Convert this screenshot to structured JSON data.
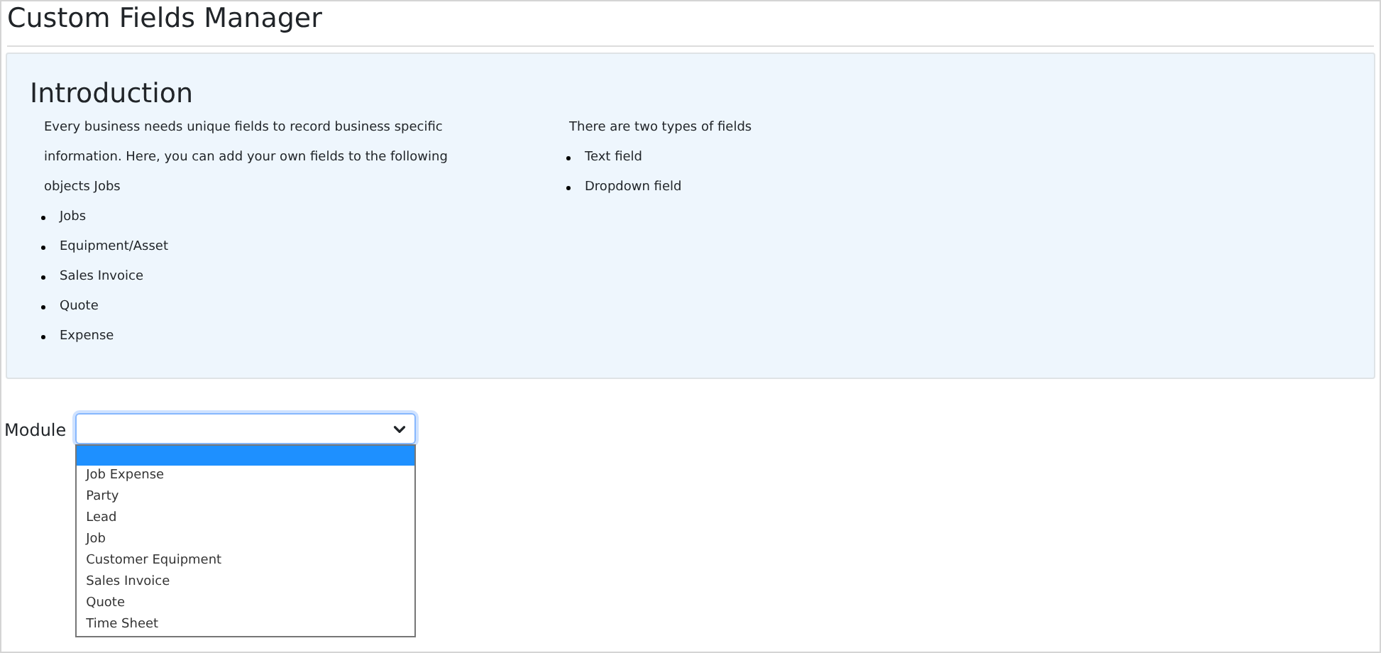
{
  "title": "Custom Fields Manager",
  "intro": {
    "heading": "Introduction",
    "paragraph": "Every business needs unique fields to record business specific information. Here, you can add your own fields to the following objects Jobs",
    "objects": [
      "Jobs",
      "Equipment/Asset",
      "Sales Invoice",
      "Quote",
      "Expense"
    ],
    "types_intro": "There are two types of fields",
    "types": [
      "Text field",
      "Dropdown field"
    ]
  },
  "module": {
    "label": "Module",
    "open": true,
    "blank_option_highlighted": true,
    "options": [
      {
        "label": "Job Expense",
        "selected": false
      },
      {
        "label": "Party",
        "selected": false
      },
      {
        "label": "Lead",
        "selected": false
      },
      {
        "label": "Job",
        "selected": false
      },
      {
        "label": "Customer Equipment",
        "selected": false
      },
      {
        "label": "Sales Invoice",
        "selected": false
      },
      {
        "label": "Quote",
        "selected": false
      },
      {
        "label": "Time Sheet",
        "selected": false
      }
    ]
  }
}
